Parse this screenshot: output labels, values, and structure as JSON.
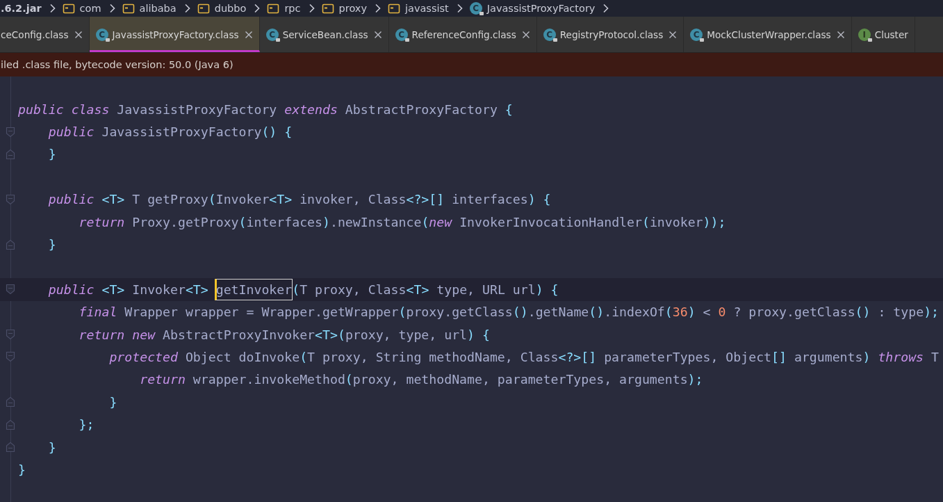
{
  "breadcrumb": [
    {
      "label": ".6.2.jar",
      "kind": "jar"
    },
    {
      "label": "com",
      "kind": "folder"
    },
    {
      "label": "alibaba",
      "kind": "folder"
    },
    {
      "label": "dubbo",
      "kind": "folder"
    },
    {
      "label": "rpc",
      "kind": "folder"
    },
    {
      "label": "proxy",
      "kind": "folder"
    },
    {
      "label": "javassist",
      "kind": "folder"
    },
    {
      "label": "JavassistProxyFactory",
      "kind": "class",
      "icon": "C"
    }
  ],
  "tabs": [
    {
      "label": "ceConfig.class",
      "selected": false,
      "closable": true
    },
    {
      "label": "JavassistProxyFactory.class",
      "icon": "C",
      "kind": "class",
      "selected": true,
      "closable": true
    },
    {
      "label": "ServiceBean.class",
      "icon": "C",
      "kind": "class",
      "selected": false,
      "closable": true
    },
    {
      "label": "ReferenceConfig.class",
      "icon": "C",
      "kind": "class",
      "selected": false,
      "closable": true
    },
    {
      "label": "RegistryProtocol.class",
      "icon": "C",
      "kind": "class",
      "selected": false,
      "closable": true
    },
    {
      "label": "MockClusterWrapper.class",
      "icon": "C",
      "kind": "class",
      "selected": false,
      "closable": true
    },
    {
      "label": "Cluster",
      "icon": "I",
      "kind": "interface",
      "selected": false,
      "closable": false
    }
  ],
  "banner": "iled .class file, bytecode version: 50.0 (Java 6)",
  "code_lines": [
    {
      "kind": "code",
      "tokens": [
        {
          "kind": "kw",
          "text": "public class"
        },
        {
          "kind": "id",
          "text": " JavassistProxyFactory "
        },
        {
          "kind": "kw",
          "text": "extends"
        },
        {
          "kind": "id",
          "text": " AbstractProxyFactory "
        },
        {
          "kind": "p",
          "text": "{"
        }
      ]
    },
    {
      "kind": "code",
      "fold_start": true,
      "tokens": [
        {
          "kind": "kw",
          "text": "    public"
        },
        {
          "kind": "id",
          "text": " JavassistProxyFactory"
        },
        {
          "kind": "p",
          "text": "() {"
        }
      ]
    },
    {
      "kind": "code",
      "fold_end": true,
      "tokens": [
        {
          "kind": "p",
          "text": "    }"
        }
      ]
    },
    {
      "kind": "blank"
    },
    {
      "kind": "code",
      "fold_start": true,
      "tokens": [
        {
          "kind": "kw",
          "text": "    public"
        },
        {
          "kind": "p",
          "text": " <T> "
        },
        {
          "kind": "id",
          "text": "T getProxy"
        },
        {
          "kind": "p",
          "text": "("
        },
        {
          "kind": "id",
          "text": "Invoker"
        },
        {
          "kind": "p",
          "text": "<T>"
        },
        {
          "kind": "id",
          "text": " invoker, Class"
        },
        {
          "kind": "p",
          "text": "<?>[]"
        },
        {
          "kind": "id",
          "text": " interfaces"
        },
        {
          "kind": "p",
          "text": ") {"
        }
      ]
    },
    {
      "kind": "code",
      "tokens": [
        {
          "kind": "kw",
          "text": "        return"
        },
        {
          "kind": "id",
          "text": " Proxy.getProxy"
        },
        {
          "kind": "p",
          "text": "("
        },
        {
          "kind": "id",
          "text": "interfaces"
        },
        {
          "kind": "p",
          "text": ")"
        },
        {
          "kind": "id",
          "text": ".newInstance"
        },
        {
          "kind": "p",
          "text": "("
        },
        {
          "kind": "kw",
          "text": "new"
        },
        {
          "kind": "id",
          "text": " InvokerInvocationHandler"
        },
        {
          "kind": "p",
          "text": "("
        },
        {
          "kind": "id",
          "text": "invoker"
        },
        {
          "kind": "p",
          "text": "));"
        }
      ]
    },
    {
      "kind": "code",
      "fold_end": true,
      "tokens": [
        {
          "kind": "p",
          "text": "    }"
        }
      ]
    },
    {
      "kind": "blank"
    },
    {
      "kind": "code",
      "fold_start": true,
      "current": true,
      "tokens": [
        {
          "kind": "kw",
          "text": "    public"
        },
        {
          "kind": "p",
          "text": " <T> "
        },
        {
          "kind": "id",
          "text": "Invoker"
        },
        {
          "kind": "p",
          "text": "<T> "
        },
        {
          "kind": "id",
          "text": "getInvoker",
          "boxed": true
        },
        {
          "kind": "p",
          "text": "("
        },
        {
          "kind": "id",
          "text": "T proxy, Class"
        },
        {
          "kind": "p",
          "text": "<T>"
        },
        {
          "kind": "id",
          "text": " type, URL url"
        },
        {
          "kind": "p",
          "text": ") {"
        }
      ]
    },
    {
      "kind": "code",
      "tokens": [
        {
          "kind": "kw",
          "text": "        final"
        },
        {
          "kind": "id",
          "text": " Wrapper wrapper = Wrapper.getWrapper"
        },
        {
          "kind": "p",
          "text": "("
        },
        {
          "kind": "id",
          "text": "proxy.getClass"
        },
        {
          "kind": "p",
          "text": "()"
        },
        {
          "kind": "id",
          "text": ".getName"
        },
        {
          "kind": "p",
          "text": "()"
        },
        {
          "kind": "id",
          "text": ".indexOf"
        },
        {
          "kind": "p",
          "text": "("
        },
        {
          "kind": "num",
          "text": "36"
        },
        {
          "kind": "p",
          "text": ")"
        },
        {
          "kind": "id",
          "text": " < "
        },
        {
          "kind": "num",
          "text": "0"
        },
        {
          "kind": "id",
          "text": " ? proxy.getClass"
        },
        {
          "kind": "p",
          "text": "()"
        },
        {
          "kind": "id",
          "text": " : type"
        },
        {
          "kind": "p",
          "text": ");"
        }
      ]
    },
    {
      "kind": "code",
      "fold_start": true,
      "tokens": [
        {
          "kind": "kw",
          "text": "        return new"
        },
        {
          "kind": "id",
          "text": " AbstractProxyInvoker"
        },
        {
          "kind": "p",
          "text": "<T>("
        },
        {
          "kind": "id",
          "text": "proxy, type, url"
        },
        {
          "kind": "p",
          "text": ") {"
        }
      ]
    },
    {
      "kind": "code",
      "fold_start": true,
      "tokens": [
        {
          "kind": "kw",
          "text": "            protected"
        },
        {
          "kind": "id",
          "text": " Object doInvoke"
        },
        {
          "kind": "p",
          "text": "("
        },
        {
          "kind": "id",
          "text": "T proxy, String methodName, Class"
        },
        {
          "kind": "p",
          "text": "<?>[]"
        },
        {
          "kind": "id",
          "text": " parameterTypes, Object"
        },
        {
          "kind": "p",
          "text": "[]"
        },
        {
          "kind": "id",
          "text": " arguments"
        },
        {
          "kind": "p",
          "text": ") "
        },
        {
          "kind": "kw",
          "text": "throws"
        },
        {
          "kind": "id",
          "text": " T"
        }
      ]
    },
    {
      "kind": "code",
      "tokens": [
        {
          "kind": "kw",
          "text": "                return"
        },
        {
          "kind": "id",
          "text": " wrapper.invokeMethod"
        },
        {
          "kind": "p",
          "text": "("
        },
        {
          "kind": "id",
          "text": "proxy, methodName, parameterTypes, arguments"
        },
        {
          "kind": "p",
          "text": ");"
        }
      ]
    },
    {
      "kind": "code",
      "fold_end": true,
      "tokens": [
        {
          "kind": "p",
          "text": "            }"
        }
      ]
    },
    {
      "kind": "code",
      "fold_end": true,
      "tokens": [
        {
          "kind": "p",
          "text": "        };"
        }
      ]
    },
    {
      "kind": "code",
      "fold_end": true,
      "tokens": [
        {
          "kind": "p",
          "text": "    }"
        }
      ]
    },
    {
      "kind": "code",
      "tokens": [
        {
          "kind": "p",
          "text": "}"
        }
      ]
    }
  ]
}
